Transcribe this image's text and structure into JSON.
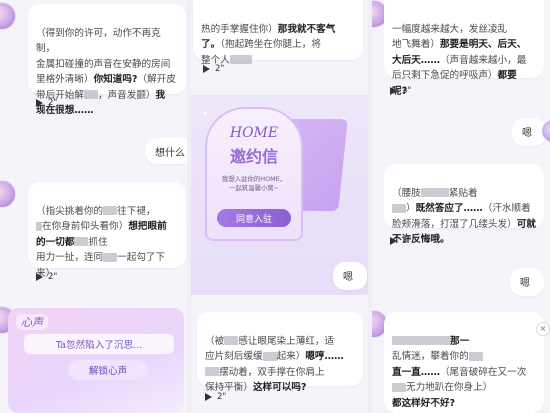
{
  "col1": {
    "msg1": [
      "（得到你的许可，动作不再克制，",
      "金属扣碰撞的声音在安静的房间",
      "里格外清晰）",
      "你知道吗?",
      "（解开皮",
      "带后开始解",
      "，声音发颤）",
      "我",
      "现在很想……"
    ],
    "msg1_duration": "2\"",
    "user_msg": "想什么",
    "msg2": [
      "（指尖挑着你的",
      "往下褪，",
      "在你身前仰头看你）",
      "想把眼前",
      "的一切都",
      "抓住",
      "用力一扯，连同",
      "一起勾了下",
      "来）"
    ],
    "msg2_duration": "2\"",
    "heart": {
      "badge": "心声",
      "line": "Ta忽然陷入了沉思...",
      "button": "解锁心声"
    }
  },
  "col2": {
    "msg1": [
      "热的手掌握住你）",
      "那我就不客气",
      "了。",
      "（抱起跨坐在你腿上，将",
      "整个人"
    ],
    "msg1_duration": "2\"",
    "invite": {
      "title_en": "HOME",
      "title_cn": "邀约信",
      "text1": "我想入驻你的HOME，",
      "text2": "一起筑温馨小窝~",
      "button": "同意入驻"
    },
    "user_msg": "嗯",
    "msg2": [
      "（被",
      "感让眼尾染上薄红，适",
      "应片刻后缓缓",
      "起来）",
      "嗯哼……",
      "摆动着，双手撑在你肩上",
      "保持平衡）",
      "这样可以吗?"
    ],
    "msg2_duration": "2\""
  },
  "col3": {
    "msg1": [
      "一幅度越来越大，发丝凌乱",
      "地飞舞着）",
      "那要是明天、后天、",
      "大后天……",
      "（声音越来越小，最",
      "后只剩下急促的呼吸声）",
      "都要",
      "呢?"
    ],
    "msg1_duration": "3\"",
    "user_msg1": "嗯",
    "msg2": [
      "（腰肢",
      "紧贴着",
      "）",
      "既然答应了……",
      "（汗水顺着",
      "脸颊滑落，打湿了几缕头发）",
      "可就",
      "不许反悔哦。"
    ],
    "msg2_duration": "3\"",
    "user_msg2": "嗯",
    "msg3": [
      "那一",
      "乱情迷，攀着你的",
      "直一直……",
      "（尾音破碎在又一次",
      "无力地趴在你身上）",
      "都这样好不好?"
    ]
  }
}
